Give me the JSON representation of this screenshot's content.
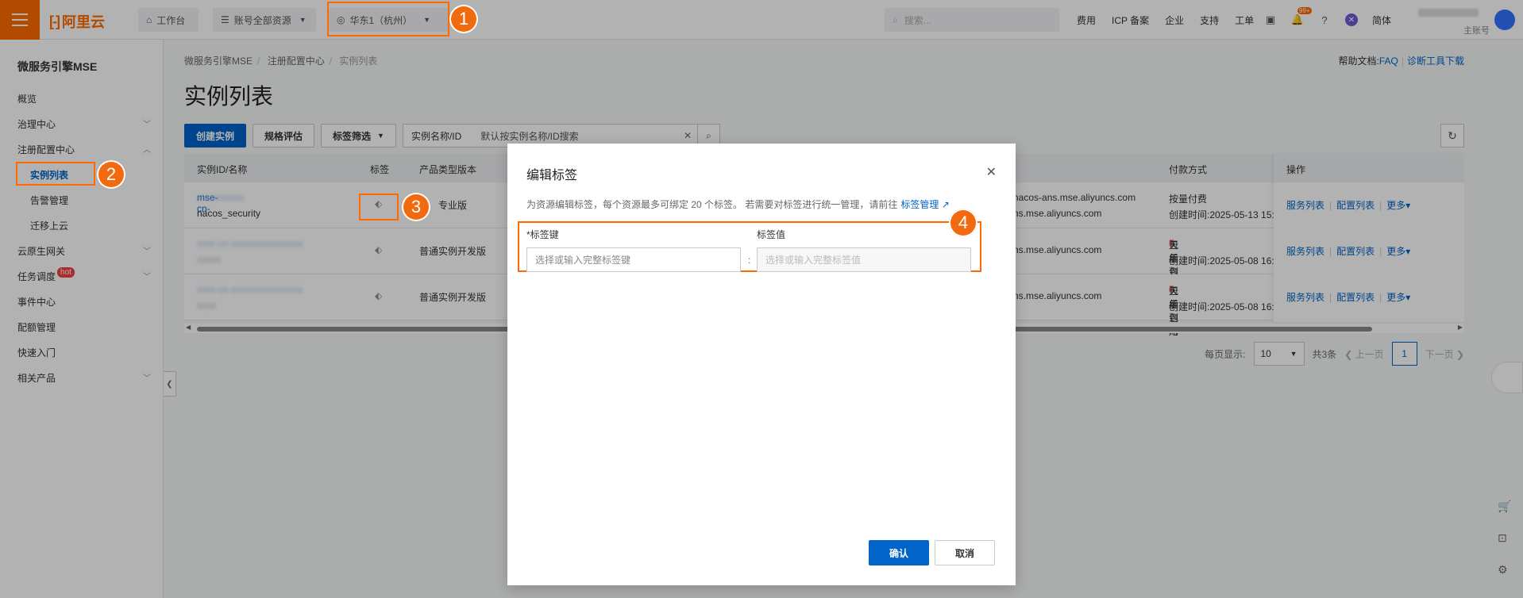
{
  "topbar": {
    "logo": "阿里云",
    "workbench": "工作台",
    "resources": "账号全部资源",
    "region": "华东1（杭州）",
    "search_placeholder": "搜索...",
    "links": [
      "费用",
      "ICP 备案",
      "企业",
      "支持",
      "工单"
    ],
    "notif_count": "99+",
    "lang": "简体",
    "account_sub": "主账号"
  },
  "sidebar": {
    "title": "微服务引擎MSE",
    "items": [
      {
        "label": "概览"
      },
      {
        "label": "治理中心"
      },
      {
        "label": "注册配置中心"
      },
      {
        "label": "实例列表"
      },
      {
        "label": "告警管理"
      },
      {
        "label": "迁移上云"
      },
      {
        "label": "云原生网关"
      },
      {
        "label": "任务调度",
        "badge": "hot"
      },
      {
        "label": "事件中心"
      },
      {
        "label": "配额管理"
      },
      {
        "label": "快速入门"
      },
      {
        "label": "相关产品"
      }
    ]
  },
  "breadcrumb": [
    "微服务引擎MSE",
    "注册配置中心",
    "实例列表"
  ],
  "help": {
    "label": "帮助文档:",
    "faq": "FAQ",
    "diag": "诊断工具下载"
  },
  "page_title": "实例列表",
  "toolbar": {
    "create": "创建实例",
    "spec": "规格评估",
    "tag_filter": "标签筛选",
    "search_key": "实例名称/ID",
    "search_placeholder": "默认按实例名称/ID搜索"
  },
  "table": {
    "headers": [
      "实例ID/名称",
      "标签",
      "产品类型版本",
      "付款方式",
      "操作"
    ],
    "rows": [
      {
        "id": "mse-cn-",
        "name": "nacos_security",
        "type": "专业版",
        "addr1": "nacos-ans.mse.aliyuncs.com",
        "addr2": "ns.mse.aliyuncs.com",
        "pay": "按量付费",
        "created": "创建时间:2025-05-13 15:"
      },
      {
        "id": "",
        "name": "",
        "type": "普通实例开发版",
        "addr1": "",
        "addr2": "ns.mse.aliyuncs.com",
        "pay_pre": "包年包月 ",
        "pay_days": "5",
        "pay_post": "天后到期",
        "created": "创建时间:2025-05-08 16:"
      },
      {
        "id": "",
        "name": "",
        "type": "普通实例开发版",
        "addr1": "",
        "addr2": "ns.mse.aliyuncs.com",
        "pay_pre": "包年包月 ",
        "pay_days": "5",
        "pay_post": "天后到期",
        "created": "创建时间:2025-05-08 16:"
      }
    ],
    "ops": [
      "服务列表",
      "配置列表",
      "更多▾"
    ]
  },
  "pager": {
    "per_page_label": "每页显示:",
    "per_page": "10",
    "total": "共3条",
    "prev": "上一页",
    "page": "1",
    "next": "下一页"
  },
  "modal": {
    "title": "编辑标签",
    "desc": "为资源编辑标签，每个资源最多可绑定 20 个标签。 若需要对标签进行统一管理，请前往",
    "desc_link": "标签管理",
    "key_label": "*标签键",
    "value_label": "标签值",
    "key_placeholder": "选择或输入完整标签键",
    "value_placeholder": "选择或输入完整标签值",
    "confirm": "确认",
    "cancel": "取消"
  },
  "steps": [
    "1",
    "2",
    "3",
    "4"
  ],
  "colors": {
    "accent": "#ff6a00",
    "primary": "#0064c8"
  }
}
